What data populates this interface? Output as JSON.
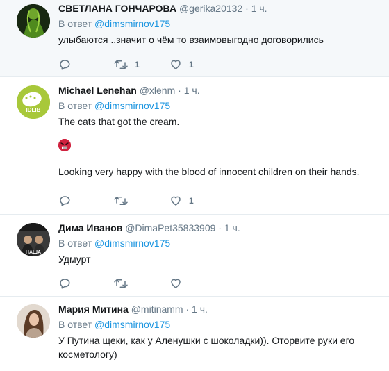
{
  "tweets": [
    {
      "name": "СВЕТЛАНА ГОНЧАРОВА",
      "handle": "@gerika20132",
      "time": "1 ч.",
      "reply_prefix": "В ответ",
      "reply_to": "@dimsmirnov175",
      "text": "улыбаются ..значит о чём то взаимовыгодно договорились",
      "retweets": "1",
      "likes": "1",
      "avatar_icon": "avatar-photo-green"
    },
    {
      "name": "Michael Lenehan",
      "handle": "@xlenm",
      "time": "1 ч.",
      "reply_prefix": "В ответ",
      "reply_to": "@dimsmirnov175",
      "text": "The cats that got the cream.",
      "text2": "Looking very happy with the blood of innocent children on their hands.",
      "emoji_icon": "angry-face-emoji",
      "retweets": "",
      "likes": "1",
      "avatar_label": "IDLIB"
    },
    {
      "name": "Дима Иванов",
      "handle": "@DimaPet35833909",
      "time": "1 ч.",
      "reply_prefix": "В ответ",
      "reply_to": "@dimsmirnov175",
      "text": "Удмурт",
      "retweets": "",
      "likes": "",
      "avatar_label": "НАША"
    },
    {
      "name": "Мария Митина",
      "handle": "@mitinamm",
      "time": "1 ч.",
      "reply_prefix": "В ответ",
      "reply_to": "@dimsmirnov175",
      "text": "У Путина щеки, как у Аленушки с шоколадки)). Оторвите руки его косметологу)"
    }
  ],
  "separator": "·",
  "colors": {
    "link": "#1b95e0",
    "muted": "#657786",
    "highlight_bg": "#f5f8fa"
  }
}
